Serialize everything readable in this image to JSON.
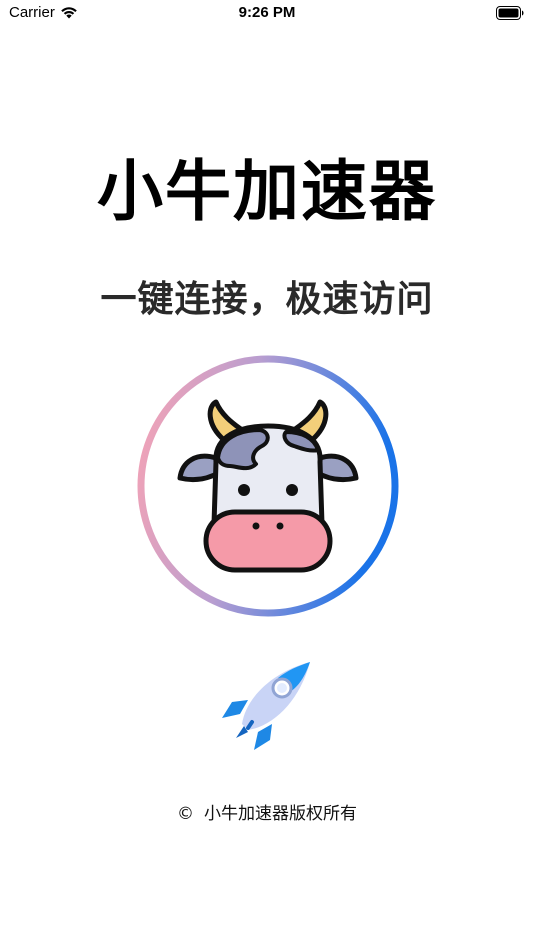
{
  "status_bar": {
    "carrier": "Carrier",
    "time": "9:26 PM"
  },
  "app": {
    "title": "小牛加速器",
    "subtitle": "一键连接，极速访问",
    "logo_icon": "cow-face-icon",
    "rocket_icon": "rocket-icon",
    "copyright_symbol": "©",
    "copyright_text": "小牛加速器版权所有"
  },
  "colors": {
    "ring_gradient_start": "#f7a3b4",
    "ring_gradient_end": "#1a73e8",
    "cow_nose": "#f59aa8",
    "cow_horn": "#f3cf7a",
    "cow_patch": "#8e93b8"
  }
}
